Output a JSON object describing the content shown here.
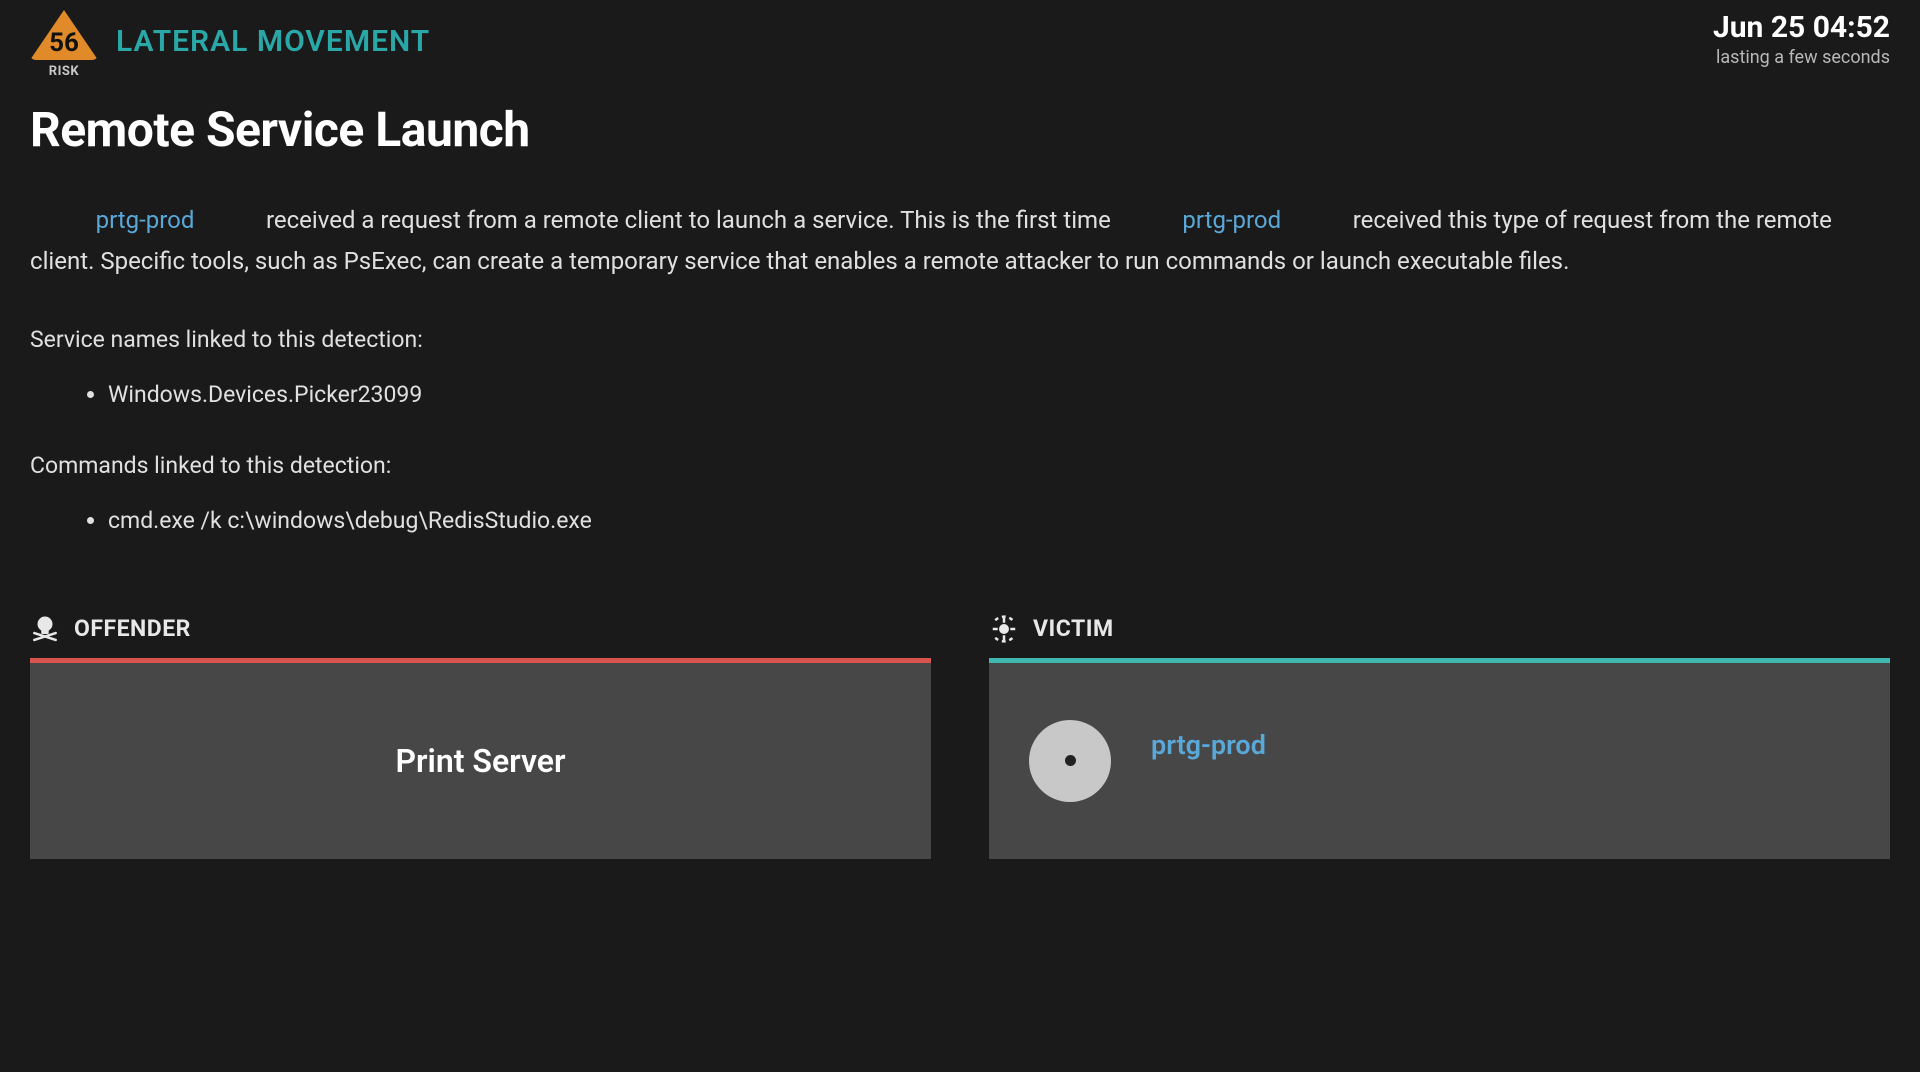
{
  "risk": {
    "score": "56",
    "label": "RISK"
  },
  "category": "LATERAL MOVEMENT",
  "timestamp": "Jun 25 04:52",
  "duration": "lasting a few seconds",
  "title": "Remote Service Launch",
  "description": {
    "host": "prtg-prod",
    "part1": " received a request from a remote client to launch a service. This is the first time ",
    "part2": " received this type of request from the remote client. Specific tools, such as PsExec, can create a temporary service that enables a remote attacker to run commands or launch executable files."
  },
  "services": {
    "label": "Service names linked to this detection:",
    "items": [
      "Windows.Devices.Picker23099"
    ]
  },
  "commands": {
    "label": "Commands linked to this detection:",
    "items": [
      "cmd.exe /k c:\\windows\\debug\\RedisStudio.exe"
    ]
  },
  "offender": {
    "heading": "OFFENDER",
    "name": "Print Server"
  },
  "victim": {
    "heading": "VICTIM",
    "name": "prtg-prod"
  }
}
